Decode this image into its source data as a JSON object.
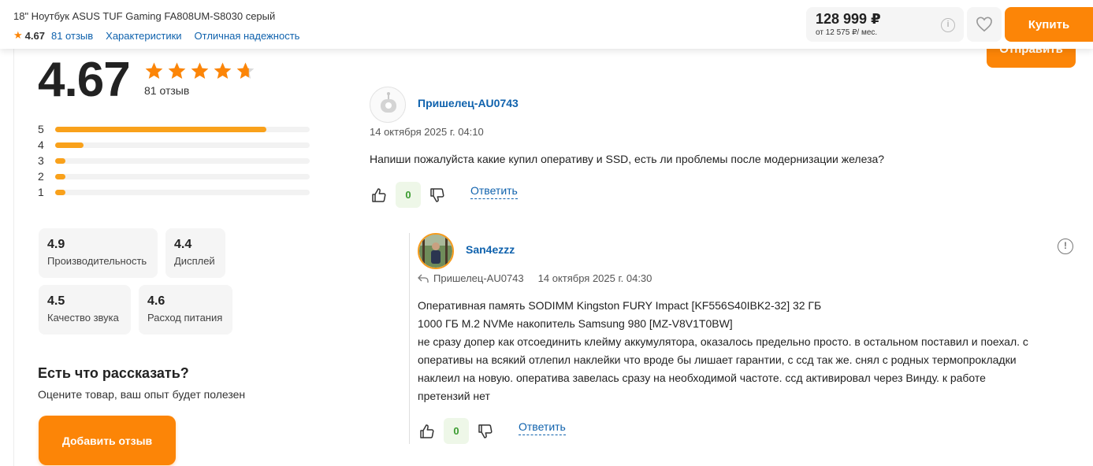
{
  "header": {
    "product_name": "18\" Ноутбук ASUS TUF Gaming FA808UM-S8030 серый",
    "rating": "4.67",
    "reviews_link": "81 отзыв",
    "specs_link": "Характеристики",
    "reliability_link": "Отличная надежность",
    "price": "128 999 ₽",
    "monthly": "от 12 575 ₽/ мес.",
    "info_icon": "i",
    "buy_label": "Купить"
  },
  "send_label": "Отправить",
  "summary": {
    "rating": "4.67",
    "stars_value": 4.67,
    "reviews_count": "81 отзыв",
    "distribution": [
      {
        "label": "5",
        "fraction": 0.83
      },
      {
        "label": "4",
        "fraction": 0.11
      },
      {
        "label": "3",
        "fraction": 0.04
      },
      {
        "label": "2",
        "fraction": 0.04
      },
      {
        "label": "1",
        "fraction": 0.04
      }
    ],
    "aspects": [
      {
        "value": "4.9",
        "name": "Производительность"
      },
      {
        "value": "4.4",
        "name": "Дисплей"
      },
      {
        "value": "4.5",
        "name": "Качество звука"
      },
      {
        "value": "4.6",
        "name": "Расход питания"
      }
    ]
  },
  "cta": {
    "title": "Есть что рассказать?",
    "subtitle": "Оцените товар, ваш опыт будет полезен",
    "button": "Добавить отзыв"
  },
  "comment": {
    "author": "Пришелец-AU0743",
    "date": "14 октября 2025 г. 04:10",
    "text": "Напиши пожалуйста какие купил оперативу и SSD, есть ли проблемы после модернизации железа?",
    "likes": "0",
    "reply_label": "Ответить"
  },
  "reply": {
    "author": "San4ezzz",
    "reply_to": "Пришелец-AU0743",
    "date": "14 октября 2025 г. 04:30",
    "lines": [
      "Оперативная память SODIMM Kingston FURY Impact [KF556S40IBK2-32] 32 ГБ",
      "1000 ГБ M.2 NVMe накопитель Samsung 980 [MZ-V8V1T0BW]",
      "не сразу допер как отсоединить клейму аккумулятора, оказалось предельно просто. в остальном поставил и поехал. с",
      "оперативы на всякий отлепил наклейки что вроде бы лишает гарантии, с ссд так же. снял с родных термопрокладки",
      "наклеил на новую. оператива завелась сразу на необходимой частоте. ссд активировал через Винду. к работе",
      "претензий нет"
    ],
    "likes": "0",
    "reply_label": "Ответить",
    "report_icon": "!"
  }
}
